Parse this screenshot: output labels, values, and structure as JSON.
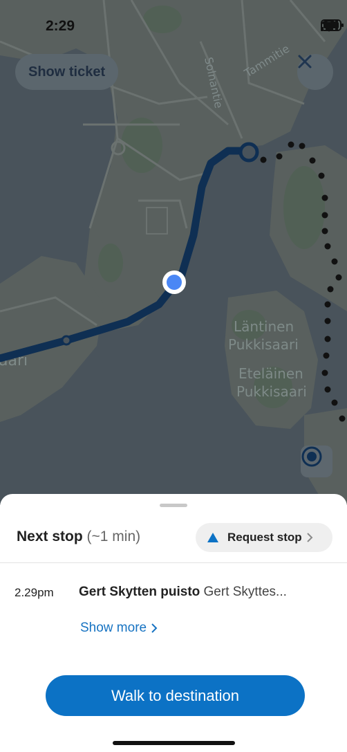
{
  "status_bar": {
    "time": "2:29"
  },
  "map": {
    "buttons": {
      "show_ticket": "Show ticket"
    },
    "labels": {
      "street1": "Solnantie",
      "street2": "Tammitie",
      "island1_line1": "Läntinen",
      "island1_line2": "Pukkisaari",
      "island2_line1": "Eteläinen",
      "island2_line2": "Pukkisaari",
      "partial_left": "aari"
    },
    "icons": {
      "close": "close-icon",
      "locate": "locate-me-icon",
      "user_location": "current-location-dot"
    },
    "colors": {
      "route": "#0f2f53",
      "user_dot": "#4a87f5",
      "walk_dots": "#111111"
    }
  },
  "sheet": {
    "next_stop_label": "Next stop",
    "next_stop_eta": "(~1 min)",
    "request_stop_label": "Request stop",
    "stop_time": "2.29pm",
    "stop_name": "Gert Skytten puisto",
    "stop_sub": "Gert Skyttes...",
    "show_more": "Show more",
    "cta": "Walk to destination",
    "colors": {
      "accent": "#0c72c5",
      "link": "#1773c2"
    }
  }
}
